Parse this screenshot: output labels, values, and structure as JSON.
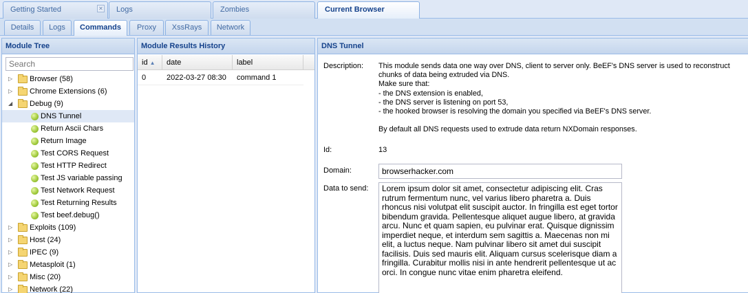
{
  "top_tabs": [
    {
      "label": "Getting Started"
    },
    {
      "label": "Logs"
    },
    {
      "label": "Zombies"
    },
    {
      "label": "Current Browser"
    }
  ],
  "sub_tabs": [
    {
      "label": "Details"
    },
    {
      "label": "Logs"
    },
    {
      "label": "Commands"
    },
    {
      "label": "Proxy"
    },
    {
      "label": "XssRays"
    },
    {
      "label": "Network"
    }
  ],
  "module_tree": {
    "title": "Module Tree",
    "search_placeholder": "Search",
    "categories_before": [
      {
        "label": "Browser (58)"
      },
      {
        "label": "Chrome Extensions (6)"
      }
    ],
    "open_category": {
      "label": "Debug (9)"
    },
    "debug_modules": [
      {
        "label": "DNS Tunnel"
      },
      {
        "label": "Return Ascii Chars"
      },
      {
        "label": "Return Image"
      },
      {
        "label": "Test CORS Request"
      },
      {
        "label": "Test HTTP Redirect"
      },
      {
        "label": "Test JS variable passing"
      },
      {
        "label": "Test Network Request"
      },
      {
        "label": "Test Returning Results"
      },
      {
        "label": "Test beef.debug()"
      }
    ],
    "categories_after": [
      {
        "label": "Exploits (109)"
      },
      {
        "label": "Host (24)"
      },
      {
        "label": "IPEC (9)"
      },
      {
        "label": "Metasploit (1)"
      },
      {
        "label": "Misc (20)"
      },
      {
        "label": "Network (22)"
      }
    ]
  },
  "history": {
    "title": "Module Results History",
    "columns": [
      "id",
      "date",
      "label"
    ],
    "rows": [
      {
        "id": "0",
        "date": "2022-03-27 08:30",
        "label": "command 1"
      }
    ]
  },
  "dns_tunnel": {
    "title": "DNS Tunnel",
    "description_label": "Description:",
    "description_lines": [
      "This module sends data one way over DNS, client to server only. BeEF's DNS server is used to reconstruct",
      "chunks of data being extruded via DNS.",
      "Make sure that:",
      "- the DNS extension is enabled,",
      "- the DNS server is listening on port 53,",
      "- the hooked browser is resolving the domain you specified via BeEF's DNS server.",
      "By default all DNS requests used to extrude data return NXDomain responses."
    ],
    "id_label": "Id:",
    "id_value": "13",
    "domain_label": "Domain:",
    "domain_value": "browserhacker.com",
    "data_label": "Data to send:",
    "data_value": "Lorem ipsum dolor sit amet, consectetur adipiscing elit. Cras rutrum fermentum nunc, vel varius libero pharetra a. Duis rhoncus nisi volutpat elit suscipit auctor. In fringilla est eget tortor bibendum gravida. Pellentesque aliquet augue libero, at gravida arcu. Nunc et quam sapien, eu pulvinar erat. Quisque dignissim imperdiet neque, et interdum sem sagittis a. Maecenas non mi elit, a luctus neque. Nam pulvinar libero sit amet dui suscipit facilisis. Duis sed mauris elit. Aliquam cursus scelerisque diam a fringilla. Curabitur mollis nisi in ante hendrerit pellentesque ut ac orci. In congue nunc vitae enim pharetra eleifend."
  }
}
